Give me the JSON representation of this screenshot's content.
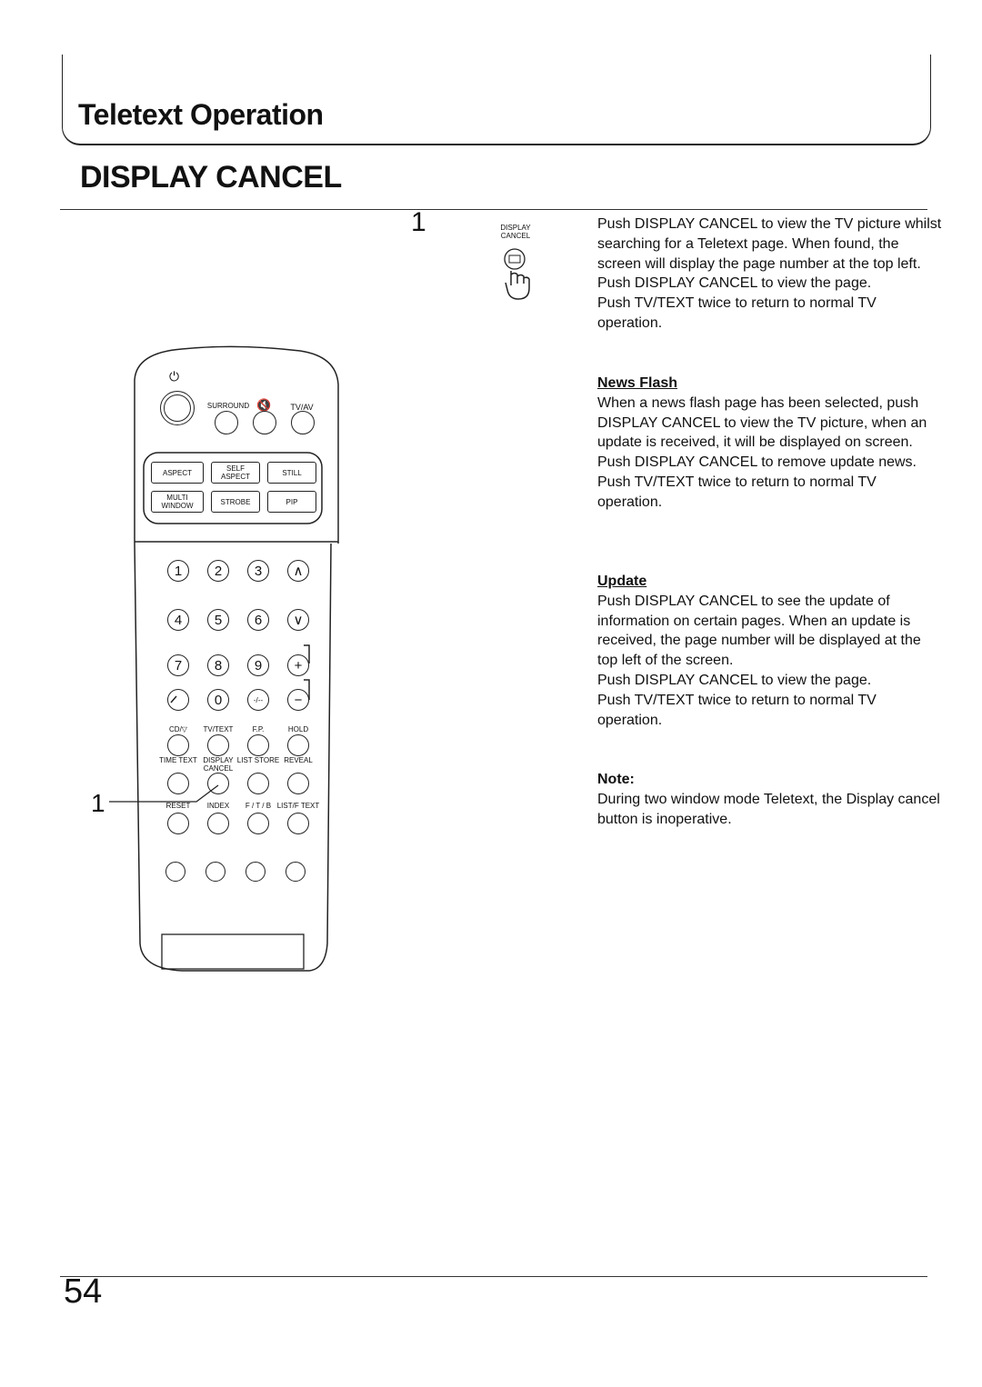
{
  "header": {
    "section": "Teletext Operation",
    "title": "DISPLAY CANCEL"
  },
  "step": {
    "number": "1",
    "button_label_line1": "DISPLAY",
    "button_label_line2": "CANCEL",
    "icon": "hand-pressing-button-icon"
  },
  "intro": [
    "Push DISPLAY CANCEL to view the TV picture whilst searching for a Teletext page. When found, the screen will display the page number at the top left.",
    "Push DISPLAY CANCEL to view the page.",
    "Push TV/TEXT twice to return to normal TV operation."
  ],
  "news_flash": {
    "heading": "News Flash",
    "paragraphs": [
      "When a news flash page has been selected, push DISPLAY CANCEL to view the TV picture, when an update is received, it will be displayed on screen.",
      "Push DISPLAY CANCEL to remove update news.",
      "Push TV/TEXT twice to return to normal TV operation."
    ]
  },
  "update": {
    "heading": "Update",
    "paragraphs": [
      "Push DISPLAY CANCEL to see the update of information on certain pages. When an update is received, the page number will be displayed at the top left of the screen.",
      "Push DISPLAY CANCEL to view the page.",
      "Push TV/TEXT twice to return to normal TV operation."
    ]
  },
  "note": {
    "heading": "Note:",
    "text": "During two window mode Teletext, the Display cancel button is inoperative."
  },
  "remote": {
    "top_labels": [
      "SURROUND",
      "TV/AV"
    ],
    "rect_buttons": [
      "ASPECT",
      "SELF ASPECT",
      "STILL",
      "MULTI WINDOW",
      "STROBE",
      "PIP"
    ],
    "numbers": [
      "1",
      "2",
      "3",
      "∧",
      "4",
      "5",
      "6",
      "∨",
      "7",
      "8",
      "9",
      "+",
      "",
      "0",
      "-/--",
      "−"
    ],
    "teletext_labels": [
      "CD/▽",
      "TV/TEXT",
      "F.P.",
      "HOLD",
      "TIME TEXT",
      "DISPLAY CANCEL",
      "LIST STORE",
      "REVEAL",
      "RESET",
      "INDEX",
      "F / T / B",
      "LIST/F TEXT"
    ],
    "callout": "1"
  },
  "page_number": "54"
}
